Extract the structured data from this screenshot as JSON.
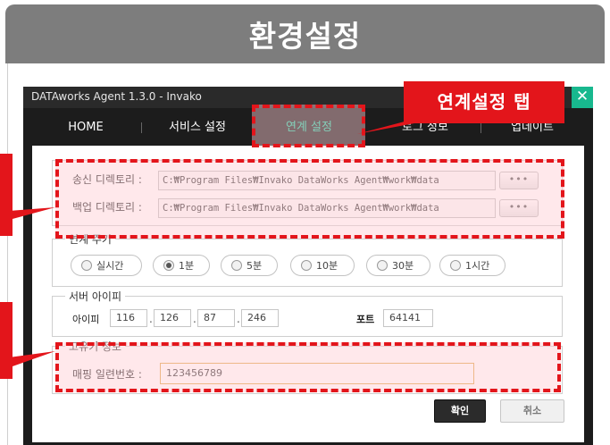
{
  "banner": {
    "title": "환경설정"
  },
  "window": {
    "title": "DATAworks Agent 1.3.0 - Invako",
    "close_glyph": "✕",
    "tabs": [
      {
        "label": "HOME"
      },
      {
        "label": "서비스 설정"
      },
      {
        "label": "연계 설정"
      },
      {
        "label": "로그 정보"
      },
      {
        "label": "업데이트"
      }
    ],
    "active_tab": "연계 설정"
  },
  "directories": {
    "send_label": "송신 디렉토리 :",
    "send_path": "C:₩Program Files₩Invako DataWorks Agent₩work₩data",
    "backup_label": "백업 디렉토리 :",
    "backup_path": "C:₩Program Files₩Invako DataWorks Agent₩work₩data",
    "browse_label": "•••"
  },
  "cycle": {
    "legend": "연계 주기",
    "options": [
      {
        "label": "실시간"
      },
      {
        "label": "1분"
      },
      {
        "label": "5분"
      },
      {
        "label": "10분"
      },
      {
        "label": "30분"
      },
      {
        "label": "1시간"
      }
    ],
    "selected": "1분"
  },
  "server": {
    "legend": "서버 아이피",
    "ip_label": "아이피",
    "ip": [
      "116",
      "126",
      "87",
      "246"
    ],
    "ip_sep": ".",
    "port_label": "포트",
    "port": "64141"
  },
  "unique": {
    "legend": "고유키 정보",
    "serial_label": "매핑 일련번호 :",
    "serial_value": "123456789"
  },
  "buttons": {
    "ok": "확인",
    "cancel": "취소"
  },
  "annotation": {
    "callout": "연계설정 탭"
  },
  "colors": {
    "accent": "#1fd0a3",
    "annotation": "#e3151b",
    "close": "#18b88e"
  }
}
